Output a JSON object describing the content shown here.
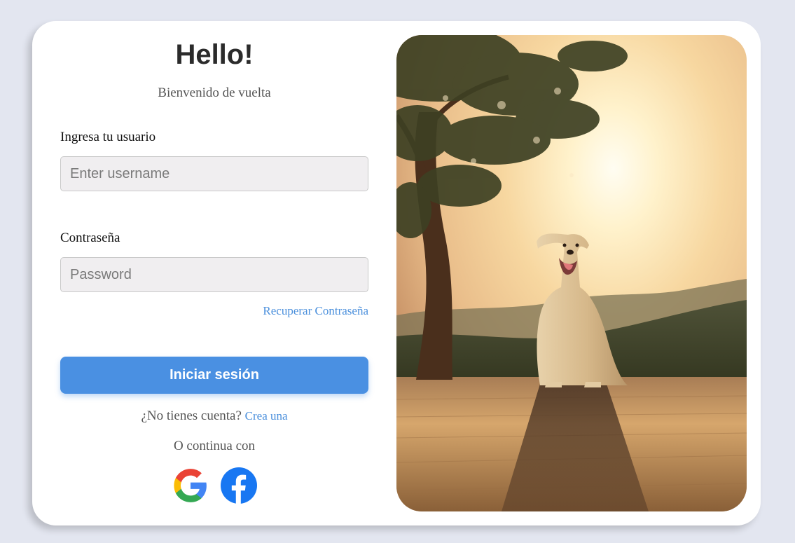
{
  "header": {
    "title": "Hello!",
    "subtitle": "Bienvenido de vuelta"
  },
  "form": {
    "username_label": "Ingresa tu usuario",
    "username_placeholder": "Enter username",
    "username_value": "",
    "password_label": "Contraseña",
    "password_placeholder": "Password",
    "password_value": "",
    "forgot_link": "Recuperar Contraseña",
    "submit_label": "Iniciar sesión"
  },
  "signup": {
    "prompt": "¿No tienes cuenta?",
    "link": "Crea una"
  },
  "social": {
    "label": "O continua con",
    "providers": [
      {
        "name": "Google",
        "icon": "google-icon"
      },
      {
        "name": "Facebook",
        "icon": "facebook-icon",
        "color": "#1877f2"
      }
    ]
  },
  "image": {
    "subject": "golden-retriever-sunset-photo"
  },
  "colors": {
    "background": "#e3e6f0",
    "primary": "#4a90e2",
    "link": "#4a8fdc",
    "input_bg": "#f0eef0"
  }
}
